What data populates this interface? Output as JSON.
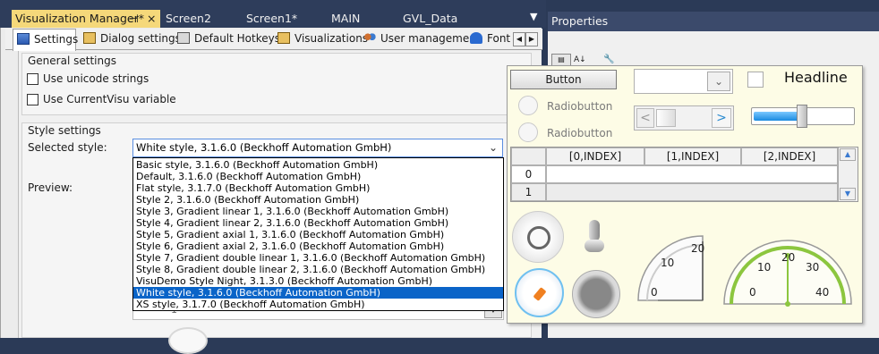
{
  "doc_tabs": [
    {
      "label": "Visualization Manager*",
      "pin": "⊣",
      "close": "×",
      "active": true
    },
    {
      "label": "Screen2",
      "active": false
    },
    {
      "label": "Screen1*",
      "active": false
    },
    {
      "label": "MAIN",
      "active": false
    },
    {
      "label": "GVL_Data",
      "active": false
    }
  ],
  "setting_tabs": [
    {
      "label": "Settings",
      "active": true
    },
    {
      "label": "Dialog settings"
    },
    {
      "label": "Default Hotkeys"
    },
    {
      "label": "Visualizations"
    },
    {
      "label": "User management"
    },
    {
      "label": "Font s"
    }
  ],
  "general": {
    "title": "General settings",
    "unicode_label": "Use unicode strings",
    "currentvisu_label": "Use CurrentVisu variable"
  },
  "style": {
    "title": "Style settings",
    "selected_label": "Selected style:",
    "preview_label": "Preview:",
    "selected_value": "White style, 3.1.6.0 (Beckhoff Automation GmbH)",
    "options": [
      "Basic style, 3.1.6.0 (Beckhoff Automation GmbH)",
      "Default, 3.1.6.0 (Beckhoff Automation GmbH)",
      "Flat style, 3.1.7.0 (Beckhoff Automation GmbH)",
      "Style 2, 3.1.6.0 (Beckhoff Automation GmbH)",
      "Style 3, Gradient linear 1, 3.1.6.0 (Beckhoff Automation GmbH)",
      "Style 4, Gradient linear 2, 3.1.6.0 (Beckhoff Automation GmbH)",
      "Style 5, Gradient axial 1, 3.1.6.0 (Beckhoff Automation GmbH)",
      "Style 6, Gradient axial 2, 3.1.6.0 (Beckhoff Automation GmbH)",
      "Style 7, Gradient double linear 1, 3.1.6.0 (Beckhoff Automation GmbH)",
      "Style 8, Gradient double linear 2, 3.1.6.0 (Beckhoff Automation GmbH)",
      "VisuDemo Style Night, 3.1.3.0 (Beckhoff Automation GmbH)",
      "White style, 3.1.6.0 (Beckhoff Automation GmbH)",
      "XS style, 3.1.7.0 (Beckhoff Automation GmbH)"
    ],
    "selected_index": 11
  },
  "properties": {
    "title": "Properties"
  },
  "preview": {
    "button_label": "Button",
    "headline": "Headline",
    "radio1": "Radiobutton",
    "radio2": "Radiobutton",
    "slider_level": 0.5,
    "table_headers": [
      "[0,INDEX]",
      "[1,INDEX]",
      "[2,INDEX]"
    ],
    "table_rows": [
      "0",
      "1"
    ],
    "background_row_label": "1",
    "gauge1": {
      "ticks": [
        "20",
        "10",
        "0"
      ]
    },
    "gauge2": {
      "ticks": [
        "20",
        "10",
        "30",
        "0",
        "40"
      ]
    }
  },
  "colors": {
    "accent": "#0a64c8",
    "tab_active": "#f5d87a",
    "preview_bg": "#fdfce6",
    "gauge_green": "#8cc63f"
  }
}
